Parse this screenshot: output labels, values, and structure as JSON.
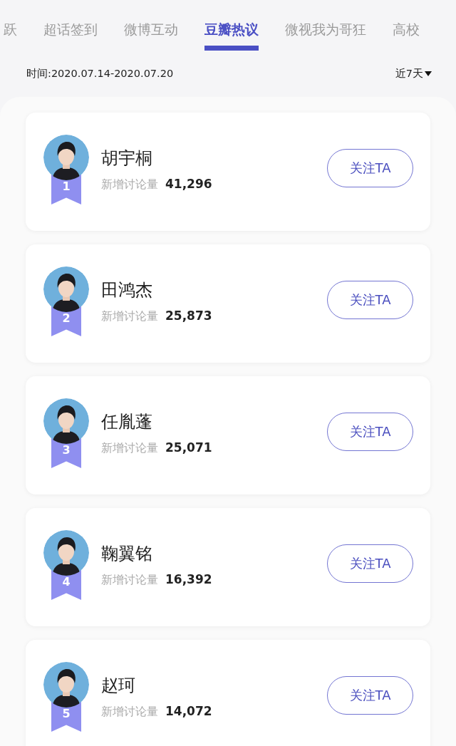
{
  "tabs": [
    {
      "label": "跃",
      "selected": false
    },
    {
      "label": "超话签到",
      "selected": false
    },
    {
      "label": "微博互动",
      "selected": false
    },
    {
      "label": "豆瓣热议",
      "selected": true
    },
    {
      "label": "微视我为哥狂",
      "selected": false
    },
    {
      "label": "高校",
      "selected": false
    }
  ],
  "period": {
    "label": "时间:2020.07.14-2020.07.20",
    "range_dropdown": "近7天"
  },
  "ranking": [
    {
      "rank": "1",
      "name": "胡宇桐",
      "metric_label": "新增讨论量",
      "value": "41,296",
      "button": "关注TA"
    },
    {
      "rank": "2",
      "name": "田鸿杰",
      "metric_label": "新增讨论量",
      "value": "25,873",
      "button": "关注TA"
    },
    {
      "rank": "3",
      "name": "任胤蓬",
      "metric_label": "新增讨论量",
      "value": "25,071",
      "button": "关注TA"
    },
    {
      "rank": "4",
      "name": "鞠翼铭",
      "metric_label": "新增讨论量",
      "value": "16,392",
      "button": "关注TA"
    },
    {
      "rank": "5",
      "name": "赵珂",
      "metric_label": "新增讨论量",
      "value": "14,072",
      "button": "关注TA"
    }
  ]
}
